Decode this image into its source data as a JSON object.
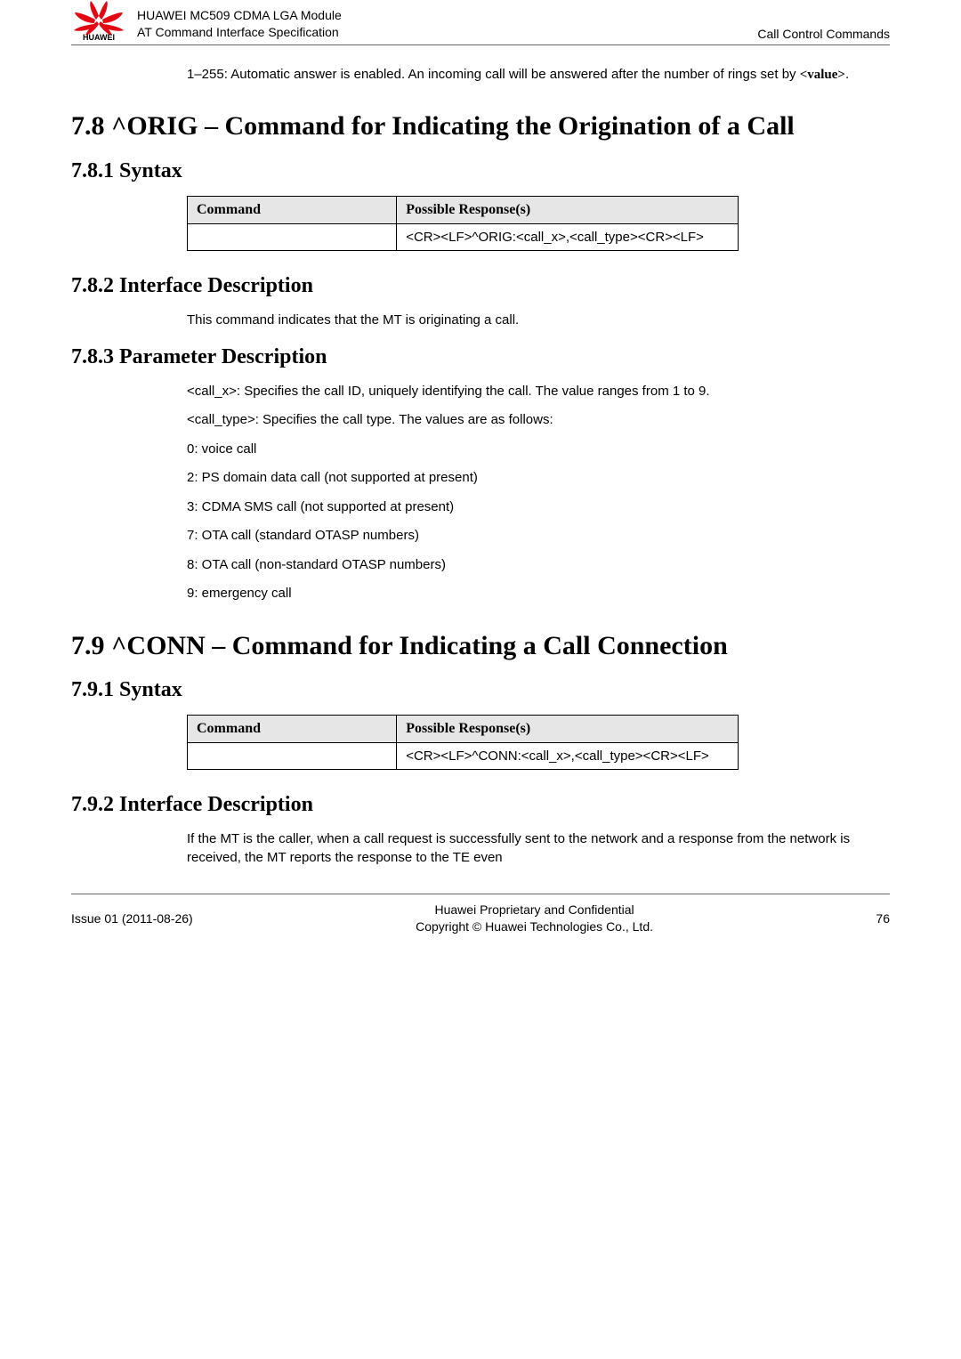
{
  "header": {
    "title_line1": "HUAWEI MC509 CDMA LGA Module",
    "title_line2": "AT Command Interface Specification",
    "right": "Call Control Commands",
    "logo_text": "HUAWEI"
  },
  "intro_para": "1–255: Automatic answer is enabled. An incoming call will be answered after the number of rings set by ",
  "intro_value": "<value>",
  "intro_tail": ".",
  "sec78": {
    "title": "7.8 ^ORIG – Command for Indicating the Origination of a Call",
    "syntax_h": "7.8.1 Syntax",
    "iface_h": "7.8.2 Interface Description",
    "iface_p": "This command indicates that the MT is originating a call.",
    "param_h": "7.8.3 Parameter Description",
    "param_items": [
      "<call_x>: Specifies the call ID, uniquely identifying the call. The value ranges from 1 to 9.",
      "<call_type>: Specifies the call type. The values are as follows:",
      "0: voice call",
      "2: PS domain data call (not supported at present)",
      "3: CDMA SMS call (not supported at present)",
      "7: OTA call (standard OTASP numbers)",
      "8: OTA call (non-standard OTASP numbers)",
      "9: emergency call"
    ],
    "table": {
      "h1": "Command",
      "h2": "Possible Response(s)",
      "r1c1": "",
      "r1c2": "<CR><LF>^ORIG:<call_x>,<call_type><CR><LF>"
    }
  },
  "sec79": {
    "title": "7.9 ^CONN – Command for Indicating a Call Connection",
    "syntax_h": "7.9.1 Syntax",
    "iface_h": "7.9.2 Interface Description",
    "iface_p": "If the MT is the caller, when a call request is successfully sent to the network and a response from the network is received, the MT reports the response to the TE even",
    "table": {
      "h1": "Command",
      "h2": "Possible Response(s)",
      "r1c1": "",
      "r1c2": "<CR><LF>^CONN:<call_x>,<call_type><CR><LF>"
    }
  },
  "footer": {
    "left": "Issue 01 (2011-08-26)",
    "center_l1": "Huawei Proprietary and Confidential",
    "center_l2": "Copyright © Huawei Technologies Co., Ltd.",
    "right": "76"
  }
}
